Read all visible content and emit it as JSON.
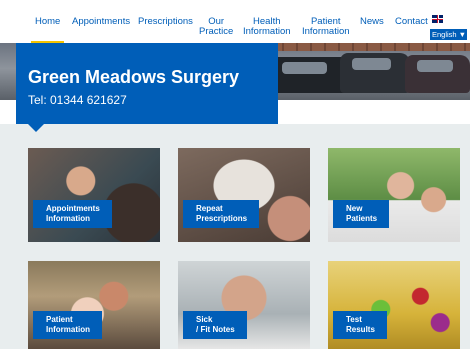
{
  "nav": {
    "items": [
      {
        "label": "Home",
        "active": true
      },
      {
        "label": "Appointments",
        "active": false
      },
      {
        "label": "Prescriptions",
        "active": false
      },
      {
        "label": "Our\nPractice",
        "active": false
      },
      {
        "label": "Health\nInformation",
        "active": false
      },
      {
        "label": "Patient\nInformation",
        "active": false
      },
      {
        "label": "News",
        "active": false
      },
      {
        "label": "Contact",
        "active": false
      }
    ],
    "language": "English ▼",
    "flag_icon": "uk-flag-icon"
  },
  "header": {
    "surgery_name": "Green Meadows Surgery",
    "telephone": "Tel: 01344 621627"
  },
  "tiles": [
    {
      "line1": "Appointments",
      "line2": "Information"
    },
    {
      "line1": "Repeat",
      "line2": "Prescriptions"
    },
    {
      "line1": "New",
      "line2": "Patients"
    },
    {
      "line1": "Patient",
      "line2": "Information"
    },
    {
      "line1": "Sick",
      "line2": "/ Fit Notes"
    },
    {
      "line1": "Test",
      "line2": "Results"
    }
  ],
  "colors": {
    "brand_blue": "#005eb8",
    "active_underline": "#f5c400",
    "content_bg": "#e8edee"
  }
}
